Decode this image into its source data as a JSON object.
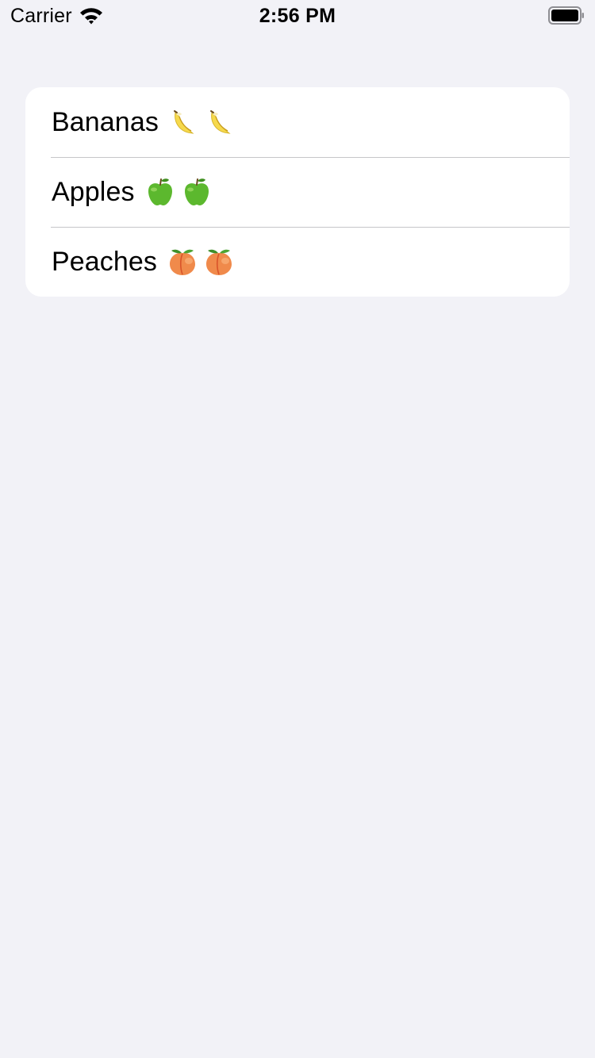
{
  "status_bar": {
    "carrier": "Carrier",
    "time": "2:56 PM",
    "icons": [
      "wifi-icon",
      "battery-icon"
    ]
  },
  "list": {
    "items": [
      {
        "label": "Bananas",
        "icon": "banana-icon",
        "icon_count": 2
      },
      {
        "label": "Apples",
        "icon": "green-apple-icon",
        "icon_count": 2
      },
      {
        "label": "Peaches",
        "icon": "peach-icon",
        "icon_count": 2
      }
    ]
  },
  "colors": {
    "background": "#f2f2f7",
    "card": "#ffffff",
    "separator": "#c6c6c8",
    "text": "#000000"
  }
}
